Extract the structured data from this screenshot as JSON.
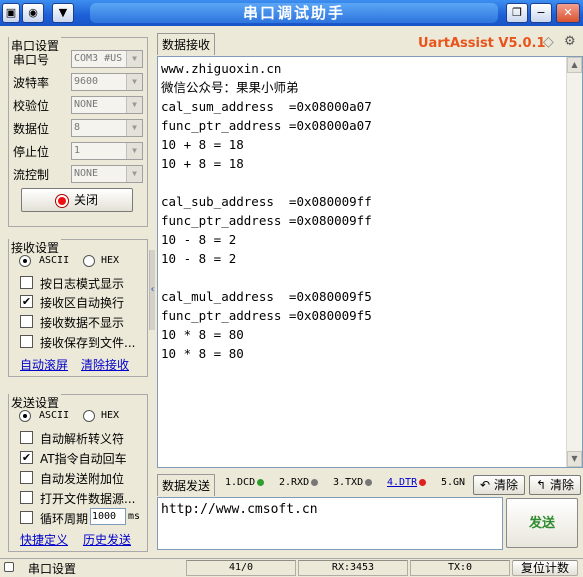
{
  "window": {
    "title": "串口调试助手",
    "menu_glyph": "▣",
    "pin_glyph": "◉",
    "down_glyph": "▼",
    "restore_glyph": "❐",
    "minimize_glyph": "−",
    "close_glyph": "✕"
  },
  "serial_settings": {
    "group_label": "串口设置",
    "rows": [
      {
        "label": "串口号",
        "value": "COM3 #US"
      },
      {
        "label": "波特率",
        "value": "9600"
      },
      {
        "label": "校验位",
        "value": "NONE"
      },
      {
        "label": "数据位",
        "value": "8"
      },
      {
        "label": "停止位",
        "value": "1"
      },
      {
        "label": "流控制",
        "value": "NONE"
      }
    ],
    "close_button": "关闭"
  },
  "receive_settings": {
    "group_label": "接收设置",
    "ascii": "ASCII",
    "hex": "HEX",
    "options": [
      {
        "label": "按日志模式显示",
        "checked": false
      },
      {
        "label": "接收区自动换行",
        "checked": true
      },
      {
        "label": "接收数据不显示",
        "checked": false
      },
      {
        "label": "接收保存到文件...",
        "checked": false
      }
    ],
    "link_auto_scroll": "自动滚屏",
    "link_clear": "清除接收"
  },
  "send_settings": {
    "group_label": "发送设置",
    "ascii": "ASCII",
    "hex": "HEX",
    "options": [
      {
        "label": "自动解析转义符",
        "checked": false
      },
      {
        "label": "AT指令自动回车",
        "checked": true
      },
      {
        "label": "自动发送附加位",
        "checked": false
      },
      {
        "label": "打开文件数据源...",
        "checked": false
      },
      {
        "label": "循环周期",
        "checked": false
      }
    ],
    "period_value": "1000",
    "period_unit": "ms",
    "link_shortcut": "快捷定义",
    "link_history": "历史发送"
  },
  "receive_area": {
    "tab_label": "数据接收",
    "brand": "UartAssist V5.0.1",
    "text": "www.zhiguoxin.cn\n微信公众号：果果小师弟\ncal_sum_address  =0x08000a07\nfunc_ptr_address =0x08000a07\n10 + 8 = 18\n10 + 8 = 18\n\ncal_sub_address  =0x080009ff\nfunc_ptr_address =0x080009ff\n10 - 8 = 2\n10 - 8 = 2\n\ncal_mul_address  =0x080009f5\nfunc_ptr_address =0x080009f5\n10 * 8 = 80\n10 * 8 = 80"
  },
  "send_area": {
    "tab_label": "数据发送",
    "pins": [
      {
        "label": "1.DCD",
        "color": "#2e9e2e"
      },
      {
        "label": "2.RXD",
        "color": "#777777"
      },
      {
        "label": "3.TXD",
        "color": "#777777"
      },
      {
        "label": "4.DTR",
        "color": "#e02020"
      },
      {
        "label": "5.GN",
        "color": ""
      }
    ],
    "clear_label": "清除",
    "clear2_label": "清除",
    "input_value": "http://www.cmsoft.cn",
    "send_button": "发送"
  },
  "status_bar": {
    "label": "串口设置",
    "progress": "41/0",
    "rx": "RX:3453",
    "tx": "TX:0",
    "reset": "复位计数"
  }
}
